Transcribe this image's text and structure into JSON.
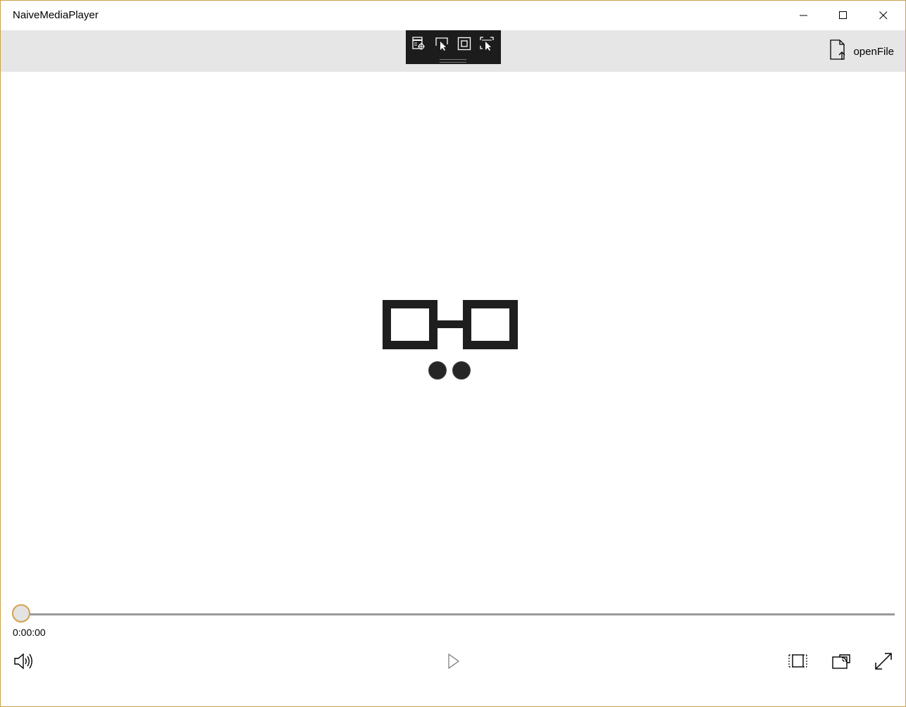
{
  "window": {
    "title": "NaiveMediaPlayer",
    "border_color": "#c9a24a"
  },
  "caption_buttons": {
    "minimize_icon": "minimize-icon",
    "maximize_icon": "maximize-icon",
    "close_icon": "close-icon"
  },
  "command_bar": {
    "background": "#e6e6e6",
    "open_file": {
      "label": "openFile",
      "icon": "open-file-icon"
    }
  },
  "devtools_toolbar": {
    "background": "#1c1c1c",
    "buttons": [
      {
        "icon": "live-visual-tree-icon"
      },
      {
        "icon": "select-element-icon"
      },
      {
        "icon": "display-layout-adorners-icon"
      },
      {
        "icon": "track-focus-icon"
      }
    ]
  },
  "media": {
    "placeholder_icon": "glasses-logo-icon"
  },
  "transport": {
    "position_fraction": 0,
    "time": "0:00:00",
    "thumb_border_color": "#d3a04d",
    "volume_icon": "volume-icon",
    "play_icon": "play-icon",
    "aspect_ratio_icon": "aspect-ratio-icon",
    "cast_icon": "cast-icon",
    "fullscreen_icon": "fullscreen-icon"
  }
}
